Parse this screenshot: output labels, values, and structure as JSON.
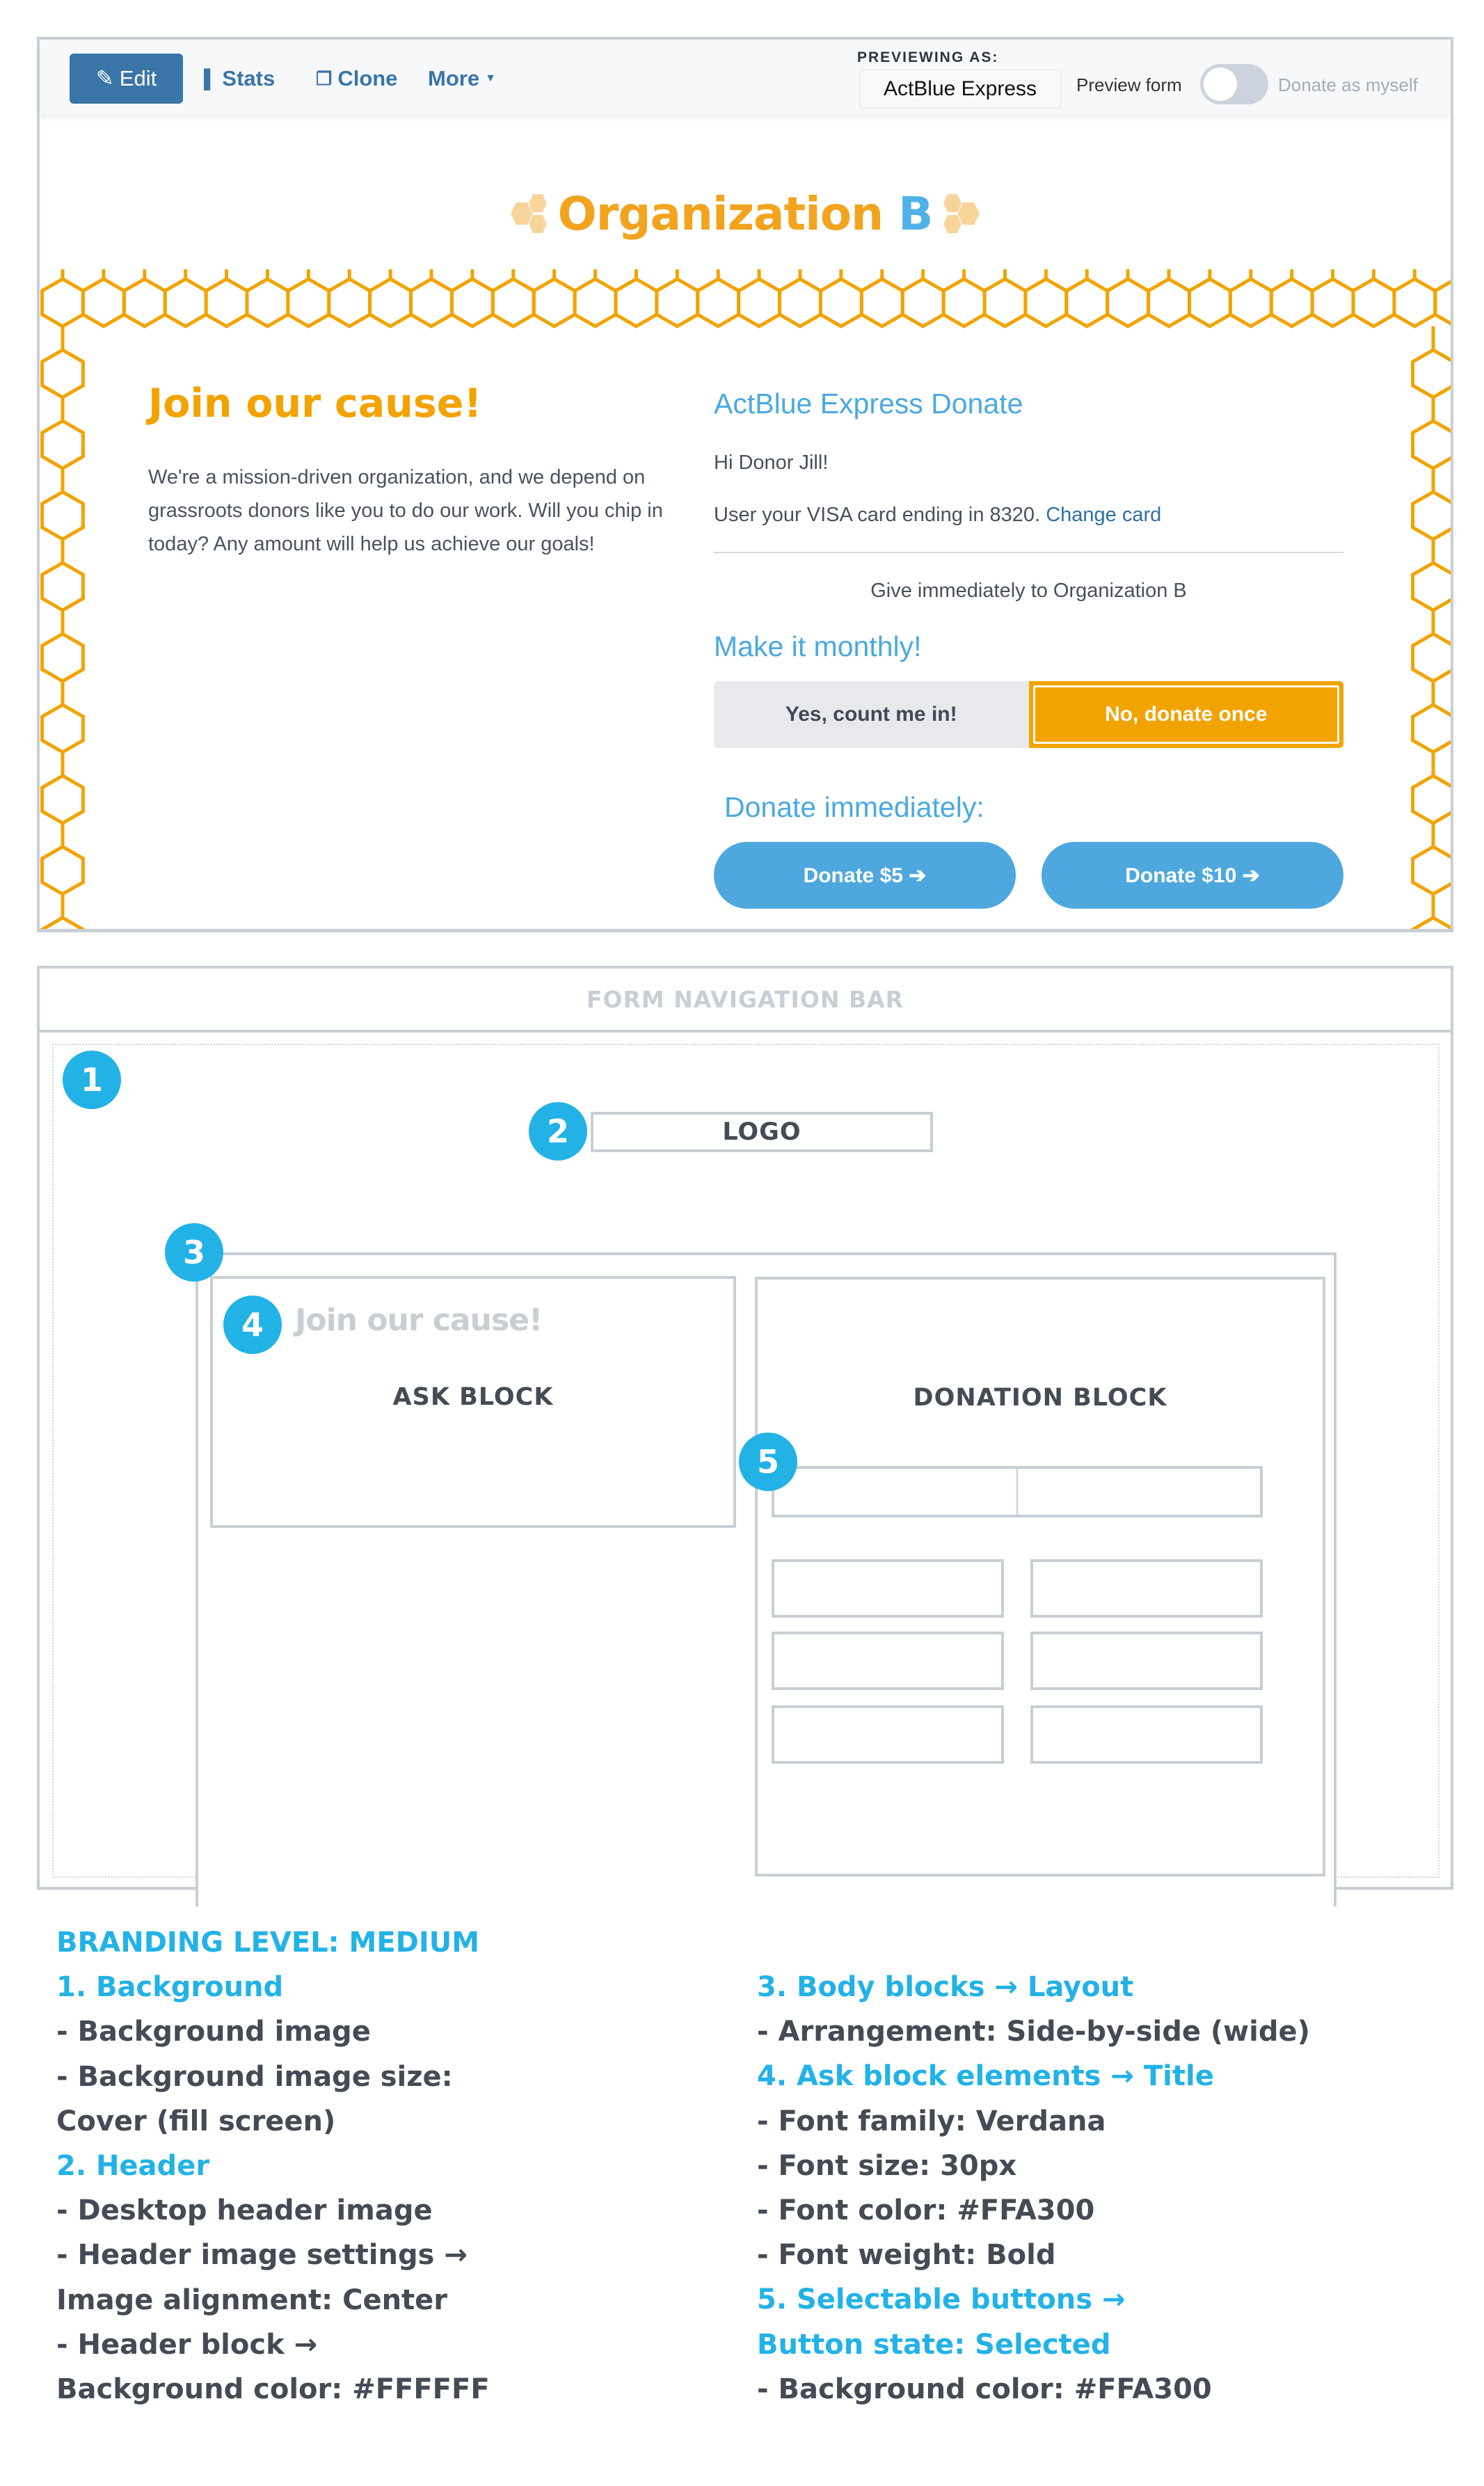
{
  "toolbar": {
    "edit_label": "Edit",
    "edit_icon": "pencil-icon",
    "stats_label": "Stats",
    "stats_icon": "bar-chart-icon",
    "clone_label": "Clone",
    "clone_icon": "copy-icon",
    "more_label": "More",
    "more_icon": "caret-down-icon",
    "previewing_as_label": "PREVIEWING AS:",
    "previewing_as_value": "ActBlue Express",
    "preview_form_label": "Preview form",
    "toggle_on": false,
    "donate_as_myself_label": "Donate as myself"
  },
  "logo": {
    "text": "Organization",
    "suffix": "B",
    "primary_color": "#F2A41E",
    "accent_color": "#4FB2E6"
  },
  "ask_block": {
    "title": "Join our cause!",
    "body": "We're a mission-driven organization, and we depend on grassroots donors like you to do our work. Will you chip in today? Any amount will help us achieve our goals!",
    "title_color": "#F2A300"
  },
  "donation_block": {
    "title": "ActBlue Express Donate",
    "greeting": "Hi Donor Jill!",
    "card_text": "User your VISA card ending in 8320.",
    "change_card_link": "Change card",
    "give_line": "Give immediately to Organization B",
    "monthly_heading": "Make it monthly!",
    "monthly_options": [
      {
        "label": "Yes, count me in!",
        "selected": false
      },
      {
        "label": "No, donate once",
        "selected": true
      }
    ],
    "immediate_heading": "Donate immediately:",
    "amount_buttons": [
      {
        "label": "Donate $5 ➔"
      },
      {
        "label": "Donate $10 ➔"
      }
    ],
    "selected_color": "#F2A300",
    "button_color": "#4EA8DE"
  },
  "wireframe": {
    "navbar_label": "FORM NAVIGATION BAR",
    "logo_label": "LOGO",
    "ask_block_label": "ASK BLOCK",
    "ask_title_sample": "Join our cause!",
    "donation_block_label": "DONATION BLOCK",
    "badges": [
      "1",
      "2",
      "3",
      "4",
      "5"
    ]
  },
  "notes": {
    "heading": "BRANDING LEVEL: MEDIUM",
    "left": [
      {
        "type": "h",
        "text": "1. Background"
      },
      {
        "type": "t",
        "text": "- Background image"
      },
      {
        "type": "t",
        "text": "- Background image size:"
      },
      {
        "type": "t",
        "text": "Cover (fill screen)"
      },
      {
        "type": "h",
        "text": "2. Header"
      },
      {
        "type": "t",
        "text": "- Desktop header image"
      },
      {
        "type": "t",
        "text": "- Header image settings →"
      },
      {
        "type": "t",
        "text": "Image alignment: Center"
      },
      {
        "type": "t",
        "text": "- Header block →"
      },
      {
        "type": "t",
        "text": "Background color: #FFFFFF"
      }
    ],
    "right": [
      {
        "type": "h",
        "text": "3. Body blocks → Layout"
      },
      {
        "type": "t",
        "text": "- Arrangement: Side-by-side (wide)"
      },
      {
        "type": "h",
        "text": "4. Ask block elements → Title"
      },
      {
        "type": "t",
        "text": "- Font family: Verdana"
      },
      {
        "type": "t",
        "text": "- Font size: 30px"
      },
      {
        "type": "t",
        "text": "- Font color: #FFA300"
      },
      {
        "type": "t",
        "text": "- Font weight: Bold"
      },
      {
        "type": "h",
        "text": "5. Selectable buttons →"
      },
      {
        "type": "h",
        "text": "Button state: Selected"
      },
      {
        "type": "t",
        "text": "- Background color: #FFA300"
      }
    ]
  }
}
